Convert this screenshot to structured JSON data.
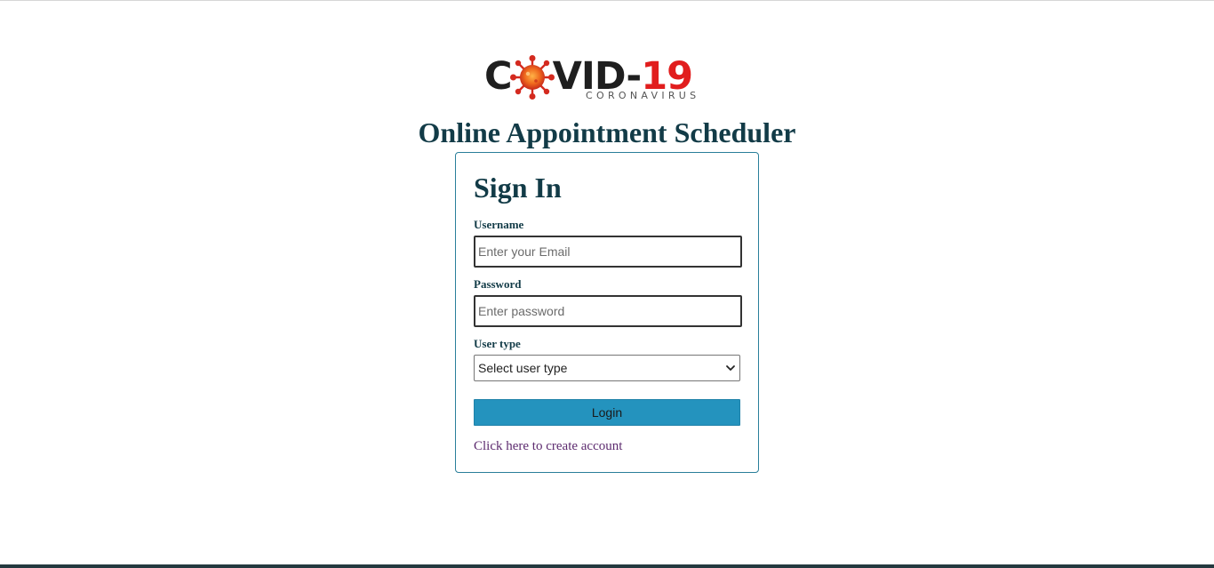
{
  "logo": {
    "word_dark_start": "C",
    "word_dark_middle": "VID-",
    "word_red": "19",
    "subtitle": "CORONAVIRUS",
    "virus_icon": "coronavirus-icon",
    "colors": {
      "dark": "#1f1f1f",
      "red": "#e11d1d",
      "virus": "#e2561f"
    }
  },
  "header": {
    "title": "Online Appointment Scheduler"
  },
  "signin": {
    "title": "Sign In",
    "username": {
      "label": "Username",
      "value": "",
      "placeholder": "Enter your Email"
    },
    "password": {
      "label": "Password",
      "value": "",
      "placeholder": "Enter password"
    },
    "user_type": {
      "label": "User type",
      "selected": "Select user type",
      "icon": "chevron-down-icon"
    },
    "login_label": "Login",
    "create_account_link": "Click here to create account"
  },
  "theme": {
    "heading_color": "#123b47",
    "accent": "#2493be",
    "card_border": "#2a7f9a",
    "link_color": "#5c2a6e",
    "footer_bar": "#24393f"
  }
}
